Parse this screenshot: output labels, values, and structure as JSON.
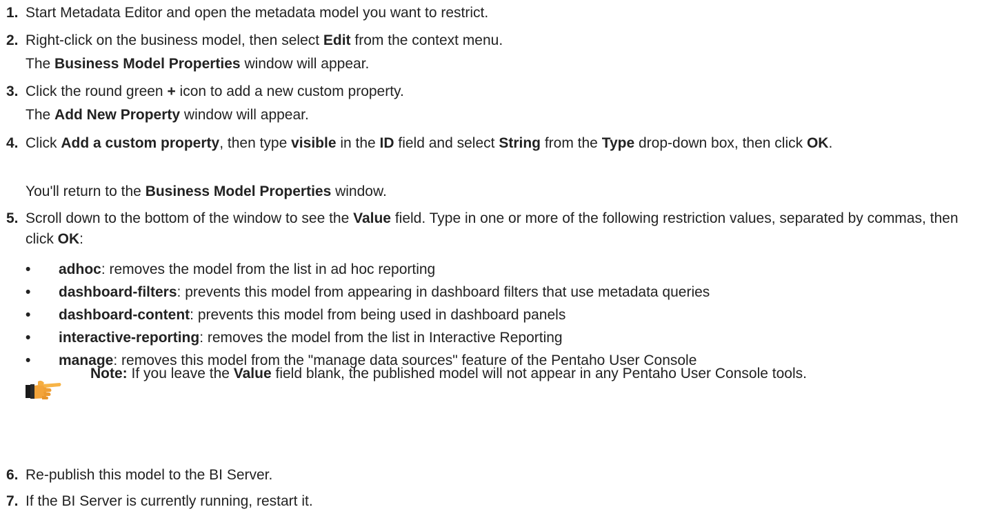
{
  "steps": [
    {
      "number": "1.",
      "parts": [
        "Start Metadata Editor and open the metadata model you want to restrict."
      ]
    },
    {
      "number": "2.",
      "parts": [
        "Right-click on the business model, then select ",
        "Edit",
        " from the context menu."
      ],
      "result": [
        "The ",
        "Business Model Properties",
        " window will appear."
      ]
    },
    {
      "number": "3.",
      "parts": [
        "Click the round green ",
        "+",
        " icon to add a new custom property."
      ],
      "result": [
        "The ",
        "Add New Property",
        " window will appear."
      ]
    },
    {
      "number": "4.",
      "parts": [
        "Click ",
        "Add a custom property",
        ", then type ",
        "visible",
        " in the ",
        "ID",
        " field and select ",
        "String",
        " from the ",
        "Type",
        " drop-down box, then click ",
        "OK",
        "."
      ],
      "result": [
        "You'll return to the ",
        "Business Model Properties",
        " window."
      ]
    },
    {
      "number": "5.",
      "parts": [
        "Scroll down to the bottom of the window to see the ",
        "Value",
        " field. Type in one or more of the following restriction values, separated by commas, then click ",
        "OK",
        ":"
      ],
      "bullets": [
        {
          "term": "adhoc",
          "desc": ": removes the model from the list in ad hoc reporting"
        },
        {
          "term": "dashboard-filters",
          "desc": ": prevents this model from appearing in dashboard filters that use metadata queries"
        },
        {
          "term": "dashboard-content",
          "desc": ": prevents this model from being used in dashboard panels"
        },
        {
          "term": "interactive-reporting",
          "desc": ": removes the model from the list in Interactive Reporting"
        },
        {
          "term": "manage",
          "desc": ": removes this model from the \"manage data sources\" feature of the Pentaho User Console"
        }
      ],
      "note": {
        "icon": "pointing-hand-icon",
        "label": "Note:",
        "parts": [
          " If you leave the ",
          "Value",
          " field blank, the published model will not appear in any Pentaho User Console tools."
        ]
      }
    },
    {
      "number": "6.",
      "parts": [
        "Re-publish this model to the BI Server."
      ]
    },
    {
      "number": "7.",
      "parts": [
        "If the BI Server is currently running, restart it."
      ]
    }
  ],
  "bullet_glyph": "•"
}
